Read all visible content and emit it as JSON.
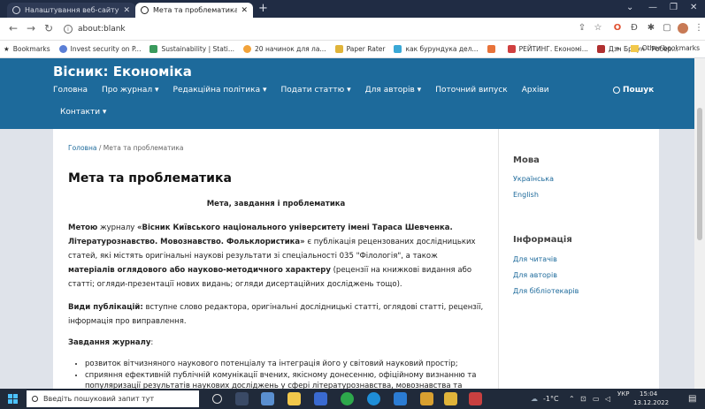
{
  "browser": {
    "tabs": [
      {
        "title": "Налаштування веб-сайту##cont"
      },
      {
        "title": "Мета та проблематика | Вісни"
      }
    ],
    "new_tab": "+",
    "address": "about:blank",
    "bookmarks_label": "Bookmarks",
    "bookmarks": [
      {
        "label": "Invest security on P...",
        "color": "#5b7fd6"
      },
      {
        "label": "Sustainability | Stati...",
        "color": "#3a9a5d"
      },
      {
        "label": "20 начинок для ла...",
        "color": "#f2a33a"
      },
      {
        "label": "Paper Rater",
        "color": "#e0b43a"
      },
      {
        "label": "как бурундука дел...",
        "color": "#3aa8d6"
      },
      {
        "label": "",
        "color": "#e8733a"
      },
      {
        "label": "РЕЙТИНГ. Економі...",
        "color": "#d04040"
      },
      {
        "label": "Дзн Браун - Робер...",
        "color": "#b03030"
      }
    ],
    "more_bookmarks": "»",
    "other_bookmarks": "Other bookmarks"
  },
  "site": {
    "title": "Вісник: Економіка",
    "menu": [
      {
        "label": "Головна",
        "arrow": ""
      },
      {
        "label": "Про журнал",
        "arrow": "▾"
      },
      {
        "label": "Редакційна політика",
        "arrow": "▾"
      },
      {
        "label": "Подати статтю",
        "arrow": "▾"
      },
      {
        "label": "Для авторів",
        "arrow": "▾"
      },
      {
        "label": "Поточний випуск",
        "arrow": ""
      },
      {
        "label": "Архіви",
        "arrow": ""
      }
    ],
    "menu2": "Контакти ▾",
    "search_label": "Пошук"
  },
  "content": {
    "breadcrumb_home": "Головна",
    "breadcrumb_sep": "/",
    "breadcrumb_current": "Мета та проблематика",
    "heading": "Мета та проблематика",
    "subtitle": "Мета, завдання і проблематика",
    "p1_b1": "Метою",
    "p1_t1": " журналу ",
    "p1_b2": "«Вісник Київського національного університету імені Тараса Шевченка. Літературознавство. Мовознавство. Фольклористика»",
    "p1_t2": " є публікація рецензованих дослідницьких статей, які містять оригінальні наукові результати зі спеціальності 035 \"Філологія\", а також ",
    "p1_b3": "матеріалів  оглядового або науково-методичного характеру",
    "p1_t3": " (рецензії  на книжкові видання або статті; огляди-презентації нових видань; огляди дисертаційних досліджень тощо).",
    "p2_b": "Види публікацій:",
    "p2_t": " вступне слово редактора, оригінальні дослідницькі статті, оглядові статті, рецензії,  інформація про виправлення.",
    "p3_b": "Завдання журналу",
    "p3_t": ":",
    "list": [
      "розвиток вітчизняного наукового потенціалу та інтеграція його у світовий науковий простір;",
      "сприяння ефективній публічній комунікації вчених, якісному донесенню, офіційному визнанню та популяризації результатів наукових досліджень у сфері літературознавства, мовознавства та"
    ]
  },
  "sidebar": {
    "lang_heading": "Мова",
    "lang_items": [
      "Українська",
      "English"
    ],
    "info_heading": "Інформація",
    "info_items": [
      "Для читачів",
      "Для авторів",
      "Для бібліотекарів"
    ]
  },
  "taskbar": {
    "search_placeholder": "Введіть пошуковий запит тут",
    "weather": "-1°C",
    "lang": "УКР",
    "time": "15:04",
    "date": "13.12.2022"
  }
}
